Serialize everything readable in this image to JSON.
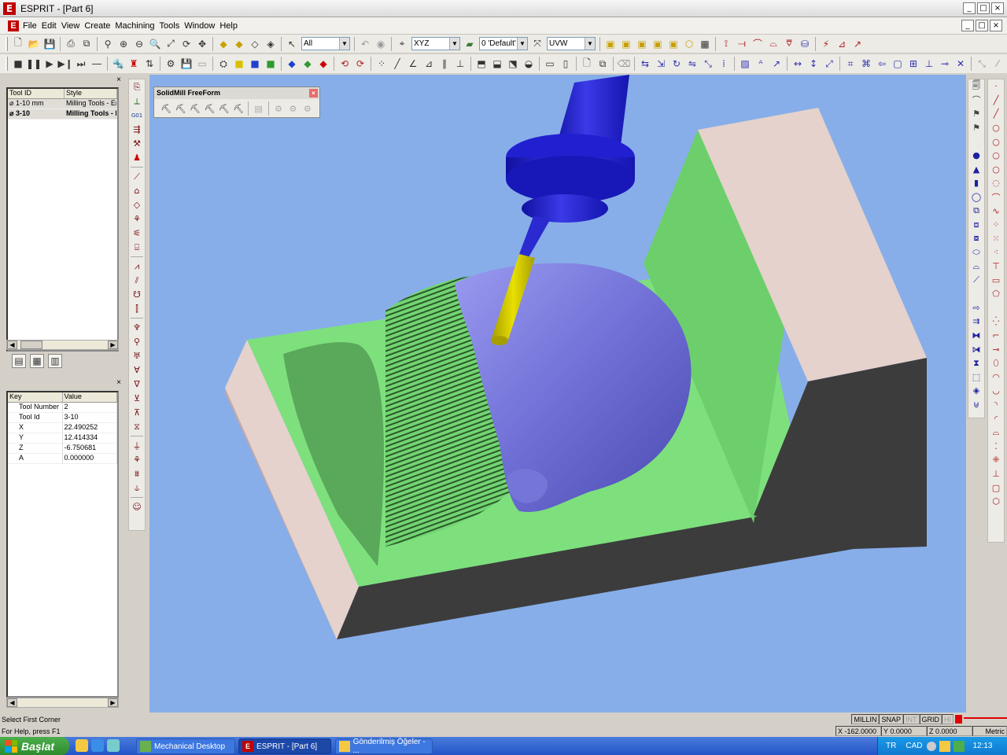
{
  "window": {
    "title": "ESPRIT - [Part 6]",
    "logo": "E",
    "min": "_",
    "max": "□",
    "close": "×"
  },
  "menu": {
    "items": [
      "File",
      "Edit",
      "View",
      "Create",
      "Machining",
      "Tools",
      "Window",
      "Help"
    ]
  },
  "toolbar": {
    "filter_select": "All",
    "cplane_select": "XYZ",
    "layer_select": "0 'Default'",
    "workplane_select": "UVW"
  },
  "tool_list": {
    "headers": [
      "Tool ID",
      "Style"
    ],
    "rows": [
      {
        "id": "1-10 mm",
        "style": "Milling Tools - End"
      },
      {
        "id": "3-10",
        "style": "Milling Tools - Ball"
      }
    ]
  },
  "properties": {
    "headers": [
      "Key",
      "Value"
    ],
    "rows": [
      {
        "key": "Tool Number",
        "value": "2"
      },
      {
        "key": "Tool Id",
        "value": "3-10"
      },
      {
        "key": "X",
        "value": "22.490252"
      },
      {
        "key": "Y",
        "value": "12.414334"
      },
      {
        "key": "Z",
        "value": "-6.750681"
      },
      {
        "key": "A",
        "value": "0.000000"
      }
    ]
  },
  "floating_toolbar": {
    "title": "SolidMill FreeForm"
  },
  "status": {
    "prompt": "Select First Corner",
    "help": "For Help, press F1",
    "modes": [
      "MILLIN",
      "SNAP",
      "INT",
      "GRID",
      "HI"
    ],
    "x": "X -162.0000",
    "y": "Y 0.0000",
    "z": "Z 0.0000",
    "units": "Metric"
  },
  "taskbar": {
    "start": "Başlat",
    "tasks": [
      "Mechanical Desktop",
      "ESPRIT - [Part 6]",
      "Gönderilmiş Öğeler - ..."
    ],
    "lang": "TR",
    "ime": "CAD",
    "clock": "12:13"
  },
  "colors": {
    "viewport_bg": "#87aee9",
    "stock_green": "#7de07d",
    "stock_side": "#e5d2cc",
    "stock_dark": "#3c3c3c",
    "model_purple": "#6f6fd6",
    "tool_yellow": "#d8d000",
    "tool_holder_blue": "#2222cc"
  },
  "icons": {
    "main_toolbar": [
      "new-icon",
      "open-icon",
      "save-icon",
      "print-icon",
      "copy-icon",
      "zoom-dynamic-icon",
      "zoom-in-icon",
      "zoom-out-icon",
      "zoom-window-icon",
      "rotate-icon",
      "pan-icon"
    ]
  }
}
